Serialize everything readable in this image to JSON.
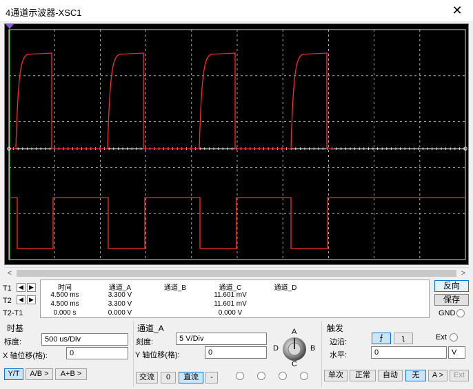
{
  "window": {
    "title": "4通道示波器-XSC1",
    "close_label": "✕"
  },
  "scope": {
    "background": "#000000",
    "grid_color": "#d8d8d8",
    "trace_color": "#ff2a2a",
    "channel_b_marker_color": "#ffffff",
    "t1_cursor_color": "#2ecc40"
  },
  "scroll": {
    "left": "<",
    "right": ">"
  },
  "cursors": [
    {
      "label": "T1"
    },
    {
      "label": "T2"
    },
    {
      "label": "T2-T1"
    }
  ],
  "readout": {
    "headers": [
      "时间",
      "通道_A",
      "通道_B",
      "通道_C",
      "通道_D"
    ],
    "rows": [
      [
        "4.500 ms",
        "3.300 V",
        "",
        "11.601 mV",
        ""
      ],
      [
        "4.500 ms",
        "3.300 V",
        "",
        "11.601 mV",
        ""
      ],
      [
        "0.000 s",
        "0.000 V",
        "",
        "0.000 V",
        ""
      ]
    ]
  },
  "side": {
    "reverse": "反向",
    "save": "保存",
    "gnd": "GND"
  },
  "timebase": {
    "title": "时基",
    "scale_label": "标度:",
    "scale_value": "500 us/Div",
    "xpos_label": "X 轴位移(格):",
    "xpos_value": "0",
    "modes": [
      "Y/T",
      "A/B >",
      "A+B >"
    ]
  },
  "channel": {
    "title": "通道_A",
    "scale_label": "刻度:",
    "scale_value": "5  V/Div",
    "ypos_label": "Y 轴位移(格):",
    "ypos_value": "0",
    "coupling": [
      "交流",
      "0",
      "直流",
      "-"
    ],
    "knob": {
      "a": "A",
      "b": "B",
      "c": "C",
      "d": "D"
    }
  },
  "trigger": {
    "title": "触发",
    "edge_label": "边沿:",
    "edge_rise": "⨍",
    "edge_fall": "ʅ",
    "ext_label": "Ext",
    "level_label": "水平:",
    "level_value": "0",
    "level_unit": "V",
    "modes": [
      "单次",
      "正常",
      "自动",
      "无",
      "A >",
      "Ext"
    ]
  }
}
